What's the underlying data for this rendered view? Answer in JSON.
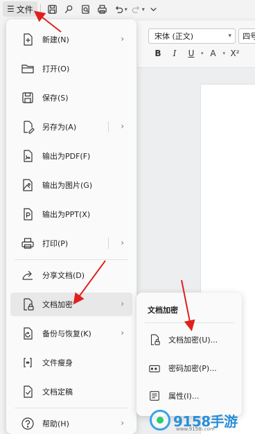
{
  "toolbar": {
    "menu_icon": "hamburger-icon",
    "file_label": "文件",
    "icons": [
      "save-icon",
      "export-icon",
      "print-preview-icon",
      "print-icon",
      "undo-icon",
      "redo-icon",
      "more-icon"
    ]
  },
  "ribbon": {
    "font_name": "宋体 (正文)",
    "font_size": "四号",
    "format_buttons": [
      "B",
      "I",
      "U",
      "A",
      "X²"
    ]
  },
  "file_menu": {
    "items": [
      {
        "label": "新建(N)",
        "icon": "new-doc-icon",
        "has_submenu": true
      },
      {
        "label": "打开(O)",
        "icon": "folder-icon",
        "has_submenu": false
      },
      {
        "label": "保存(S)",
        "icon": "save-icon",
        "has_submenu": false
      },
      {
        "label": "另存为(A)",
        "icon": "save-as-icon",
        "has_submenu": true
      },
      {
        "label": "输出为PDF(F)",
        "icon": "pdf-icon",
        "has_submenu": false
      },
      {
        "label": "输出为图片(G)",
        "icon": "image-icon",
        "has_submenu": false
      },
      {
        "label": "输出为PPT(X)",
        "icon": "ppt-icon",
        "has_submenu": false
      },
      {
        "label": "打印(P)",
        "icon": "printer-icon",
        "has_submenu": true
      },
      {
        "label": "分享文档(D)",
        "icon": "share-icon",
        "has_submenu": false
      },
      {
        "label": "文档加密",
        "icon": "lock-doc-icon",
        "has_submenu": true
      },
      {
        "label": "备份与恢复(K)",
        "icon": "backup-icon",
        "has_submenu": true
      },
      {
        "label": "文件瘦身",
        "icon": "compress-icon",
        "has_submenu": false
      },
      {
        "label": "文档定稿",
        "icon": "finalize-icon",
        "has_submenu": false
      },
      {
        "label": "帮助(H)",
        "icon": "help-icon",
        "has_submenu": true
      }
    ]
  },
  "encrypt_submenu": {
    "title": "文档加密",
    "items": [
      {
        "label": "文档加密(U)...",
        "icon": "lock-doc-icon"
      },
      {
        "label": "密码加密(P)...",
        "icon": "password-icon"
      },
      {
        "label": "属性(I)...",
        "icon": "properties-icon"
      }
    ]
  },
  "watermark": {
    "number": "9158",
    "suffix": "手游",
    "url": "www.9158i.com"
  },
  "colors": {
    "arrow": "#e02020",
    "active_item": "#e8e8e8",
    "watermark_blue": "#2a8fd8"
  }
}
